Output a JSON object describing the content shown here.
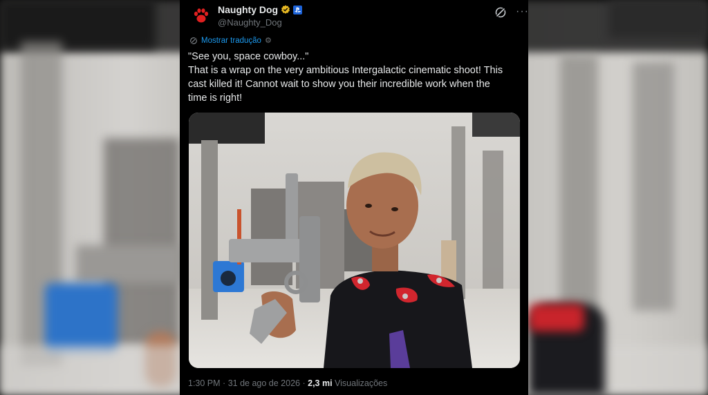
{
  "tweet": {
    "author": {
      "name": "Naughty Dog",
      "handle": "@Naughty_Dog",
      "avatar_icon": "paw-print-icon",
      "avatar_color": "#e02020",
      "verified_icon": "gold-verified-badge-icon",
      "verified_color": "#e8b923",
      "affiliate_icon": "playstation-badge-icon",
      "affiliate_color": "#1d63d8"
    },
    "actions": {
      "grok_icon": "grok-icon",
      "more_icon": "more-options-icon",
      "more_label": "···"
    },
    "translate": {
      "label": "Mostrar tradução",
      "icon": "translate-icon",
      "settings_icon": "gear-icon"
    },
    "text_lines": [
      "\"See you, space cowboy...\"",
      "That is a wrap on the very ambitious Intergalactic cinematic shoot! This",
      "cast killed it! Cannot wait to show you their incredible work when the",
      "time is right!"
    ],
    "media": {
      "kind": "photo"
    },
    "footer": {
      "time": "1:30 PM",
      "separator": "·",
      "date": "31 de ago de 2026",
      "views_count": "2,3 mi",
      "views_label": "Visualizações"
    }
  },
  "colors": {
    "background": "#000000",
    "text_primary": "#e7e9ea",
    "text_secondary": "#71767b",
    "link": "#1d9bf0"
  }
}
